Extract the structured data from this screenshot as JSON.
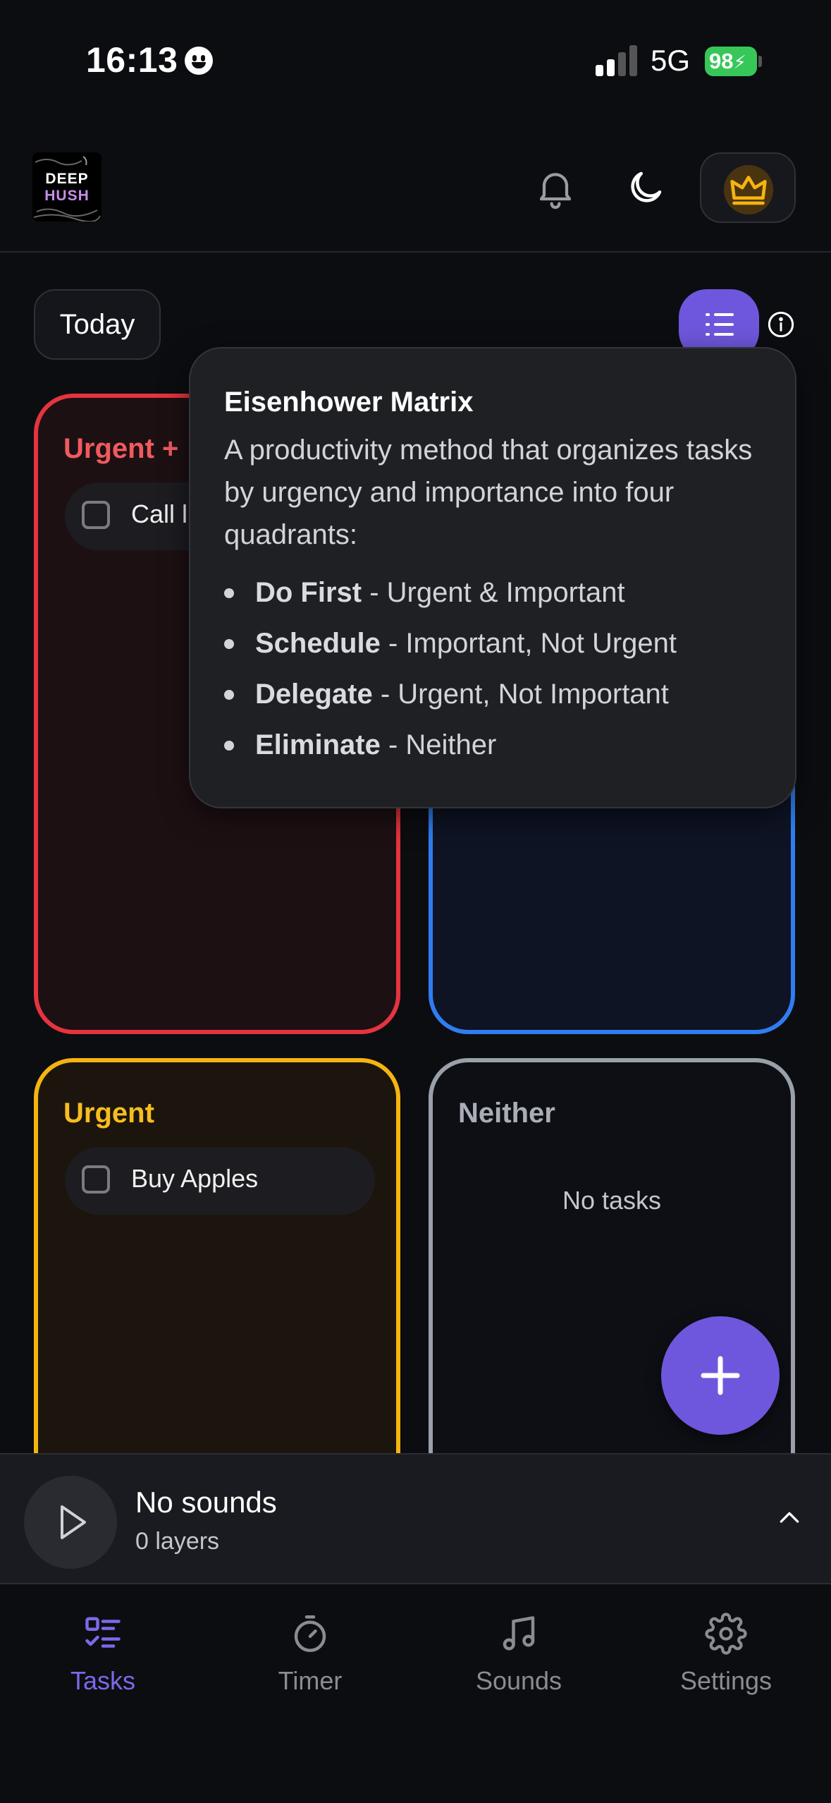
{
  "status_bar": {
    "time": "16:13",
    "network": "5G",
    "battery": "98"
  },
  "header": {
    "logo_line1": "DEEP",
    "logo_line2": "HUSH"
  },
  "toolbar": {
    "date_filter": "Today"
  },
  "quadrants": [
    {
      "title": "Urgent +",
      "color": "#e5343e",
      "tasks": [
        "Call l"
      ]
    },
    {
      "title": "",
      "color": "#2f7df0",
      "tasks": []
    },
    {
      "title": "Urgent",
      "color": "#f5b40f",
      "tasks": [
        "Buy Apples"
      ]
    },
    {
      "title": "Neither",
      "color": "#9aa0aa",
      "empty_text": "No tasks"
    }
  ],
  "tooltip": {
    "title": "Eisenhower Matrix",
    "description": "A productivity method that organizes tasks by urgency and importance into four quadrants:",
    "items": [
      {
        "label": "Do First",
        "desc": " - Urgent & Important"
      },
      {
        "label": "Schedule",
        "desc": " - Important, Not Urgent"
      },
      {
        "label": "Delegate",
        "desc": " - Urgent, Not Important"
      },
      {
        "label": "Eliminate",
        "desc": " - Neither"
      }
    ]
  },
  "player": {
    "title": "No sounds",
    "subtitle": "0 layers"
  },
  "tabs": [
    {
      "label": "Tasks",
      "icon": "tasks-icon",
      "active": true
    },
    {
      "label": "Timer",
      "icon": "timer-icon",
      "active": false
    },
    {
      "label": "Sounds",
      "icon": "music-note-icon",
      "active": false
    },
    {
      "label": "Settings",
      "icon": "gear-icon",
      "active": false
    }
  ],
  "colors": {
    "accent": "#6f57dd",
    "active_tab": "#7d68e8",
    "crown": "#f5b40f"
  }
}
